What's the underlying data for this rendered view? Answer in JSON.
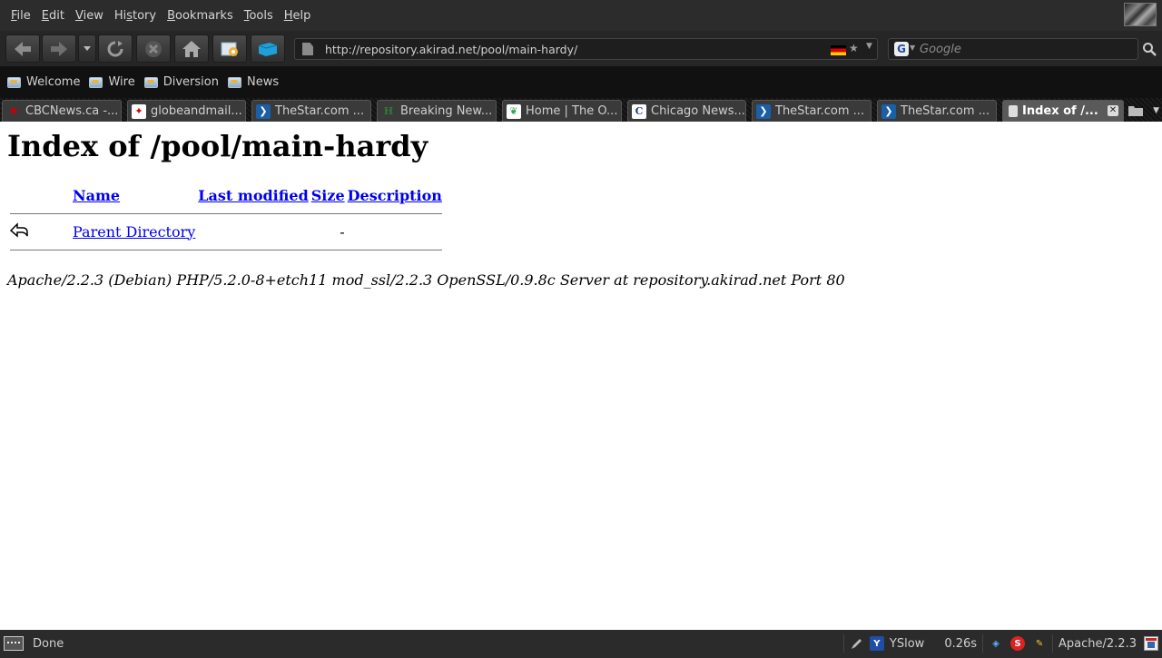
{
  "menubar": {
    "items": [
      {
        "accel": "F",
        "rest": "ile"
      },
      {
        "accel": "E",
        "rest": "dit"
      },
      {
        "accel": "V",
        "rest": "iew"
      },
      {
        "pre": "Hi",
        "accel": "s",
        "rest": "tory"
      },
      {
        "accel": "B",
        "rest": "ookmarks"
      },
      {
        "accel": "T",
        "rest": "ools"
      },
      {
        "accel": "H",
        "rest": "elp"
      }
    ]
  },
  "navbar": {
    "url": "http://repository.akirad.net/pool/main-hardy/",
    "search_placeholder": "Google"
  },
  "bookmarks": [
    {
      "label": "Welcome"
    },
    {
      "label": "Wire"
    },
    {
      "label": "Diversion"
    },
    {
      "label": "News"
    }
  ],
  "tabs": [
    {
      "title": "CBCNews.ca -...",
      "icon": "cbc-icon",
      "color": "#cc0000"
    },
    {
      "title": "globeandmail...",
      "icon": "maple-leaf-icon",
      "color": "#d40000"
    },
    {
      "title": "TheStar.com ...",
      "icon": "thestar-icon",
      "color": "#1a5fa8"
    },
    {
      "title": "Breaking New...",
      "icon": "huffpost-icon",
      "color": "#2e7d32"
    },
    {
      "title": "Home | The O...",
      "icon": "leaf-icon",
      "color": "#3aa35a"
    },
    {
      "title": "Chicago News...",
      "icon": "chicago-tribune-icon",
      "color": "#1e3e7a"
    },
    {
      "title": "TheStar.com ...",
      "icon": "thestar-icon",
      "color": "#1a5fa8"
    },
    {
      "title": "TheStar.com ...",
      "icon": "thestar-icon",
      "color": "#1a5fa8"
    },
    {
      "title": "Index of /...",
      "icon": "page-icon",
      "color": "#dddddd",
      "active": true
    }
  ],
  "page": {
    "heading": "Index of /pool/main-hardy",
    "columns": {
      "name": "Name",
      "last_modified": "Last modified",
      "size": "Size",
      "description": "Description"
    },
    "parent": {
      "label": "Parent Directory",
      "size": "-"
    },
    "address": "Apache/2.2.3 (Debian) PHP/5.2.0-8+etch11 mod_ssl/2.2.3 OpenSSL/0.9.8c Server at repository.akirad.net Port 80"
  },
  "statusbar": {
    "status": "Done",
    "yslow": "YSlow",
    "load_time": "0.26s",
    "server": "Apache/2.2.3"
  },
  "colors": {
    "link": "#0000ee",
    "menubar_bg": "#2c2c2c",
    "bookmarks_bg": "#111111"
  }
}
